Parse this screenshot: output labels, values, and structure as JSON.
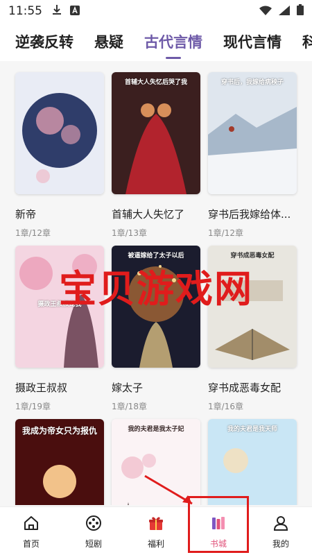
{
  "status_bar": {
    "time": "11:55"
  },
  "tabs": [
    {
      "label": "逆袭反转",
      "active": false
    },
    {
      "label": "悬疑",
      "active": false
    },
    {
      "label": "古代言情",
      "active": true
    },
    {
      "label": "现代言情",
      "active": false
    },
    {
      "label": "科幻",
      "active": false
    }
  ],
  "books": [
    {
      "title": "新帝",
      "meta": "1章/12章",
      "cover_text": "",
      "palette": [
        "#e9ecf5",
        "#2f3d6a",
        "#f2a7b8"
      ]
    },
    {
      "title": "首辅大人失忆了",
      "meta": "1章/13章",
      "cover_text": "首辅大人失忆后哭了我",
      "palette": [
        "#3b1f1f",
        "#b2232d",
        "#d88f5a"
      ]
    },
    {
      "title": "穿书后我嫁给体...",
      "meta": "1章/12章",
      "cover_text": "穿书后，我嫁给病秧子",
      "palette": [
        "#dfe6ee",
        "#6f8aa6",
        "#a33a2a"
      ]
    },
    {
      "title": "摄政王叔叔",
      "meta": "1章/19章",
      "cover_text": "摄政王叔叔宠我",
      "palette": [
        "#f4d5e1",
        "#e78aa9",
        "#7a5263"
      ]
    },
    {
      "title": "嫁太子",
      "meta": "1章/18章",
      "cover_text": "被逼嫁给了太子以后",
      "palette": [
        "#1b1c2e",
        "#e58b3a",
        "#f5d68e"
      ]
    },
    {
      "title": "穿书成恶毒女配",
      "meta": "1章/16章",
      "cover_text": "穿书成恶毒女配",
      "palette": [
        "#e8e6df",
        "#a28d6a",
        "#3b3b3b"
      ]
    },
    {
      "title": "",
      "meta": "",
      "cover_text": "我成为帝女只为报仇",
      "palette": [
        "#4a0e0e",
        "#b71c1c",
        "#f2c28a"
      ]
    },
    {
      "title": "",
      "meta": "",
      "cover_text": "我的夫君是我太子妃",
      "palette": [
        "#fbf3f5",
        "#f0b8c8",
        "#3b2b2b"
      ]
    },
    {
      "title": "",
      "meta": "",
      "cover_text": "我的夫君是我天师",
      "palette": [
        "#c9e6f5",
        "#4fa2cf",
        "#f2e0c0"
      ]
    }
  ],
  "watermark": "宝贝游戏网",
  "bottom_nav": [
    {
      "label": "首页",
      "icon": "home-icon",
      "active": false
    },
    {
      "label": "短剧",
      "icon": "film-reel-icon",
      "active": false
    },
    {
      "label": "福利",
      "icon": "gift-icon",
      "active": false
    },
    {
      "label": "书城",
      "icon": "bookshelf-icon",
      "active": true
    },
    {
      "label": "我的",
      "icon": "user-icon",
      "active": false
    }
  ],
  "colors": {
    "accent": "#6e5aa8",
    "nav_active": "#e0527a",
    "annotation_red": "#e01c1c"
  }
}
